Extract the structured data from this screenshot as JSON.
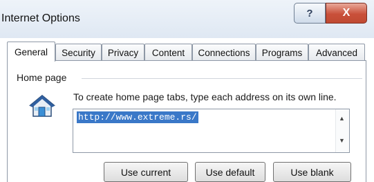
{
  "window": {
    "title": "Internet Options",
    "help_button": "?",
    "close_button": "X"
  },
  "tabs": [
    {
      "label": "General",
      "active": true
    },
    {
      "label": "Security",
      "active": false
    },
    {
      "label": "Privacy",
      "active": false
    },
    {
      "label": "Content",
      "active": false
    },
    {
      "label": "Connections",
      "active": false
    },
    {
      "label": "Programs",
      "active": false
    },
    {
      "label": "Advanced",
      "active": false
    }
  ],
  "home_page": {
    "group_label": "Home page",
    "icon": "home-icon",
    "instructions": "To create home page tabs, type each address on its own line.",
    "url_value": "http://www.extreme.rs/",
    "buttons": {
      "use_current": "Use current",
      "use_default": "Use default",
      "use_blank": "Use blank"
    }
  },
  "colors": {
    "close_red": "#c9503a",
    "selection_blue": "#3a78c8"
  }
}
